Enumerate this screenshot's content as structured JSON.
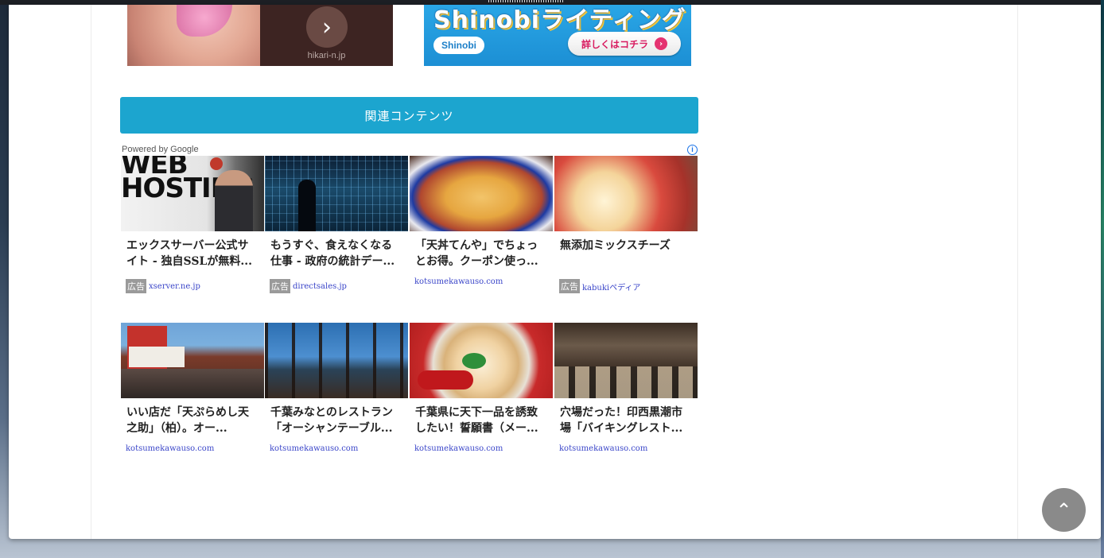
{
  "ads": {
    "left_banner": {
      "domain": "hikari-n.jp",
      "next_symbol": "›"
    },
    "right_banner": {
      "headline": "Shinobiライティング",
      "logo": "Shinobi",
      "cta": "詳しくはコチラ",
      "cta_arrow": "›"
    }
  },
  "related": {
    "header": "関連コンテンツ",
    "powered_by": "Powered by Google",
    "info_symbol": "i",
    "ad_label": "広告",
    "items": [
      {
        "title": "エックスサーバー公式サイト - 独自SSLが無料...",
        "source": "xserver.ne.jp",
        "sponsored": true
      },
      {
        "title": "もうすぐ、食えなくなる仕事 - 政府の統計デー...",
        "source": "directsales.jp",
        "sponsored": true
      },
      {
        "title": "「天丼てんや」でちょっとお得。クーポン使っ...",
        "source": "kotsumekawauso.com",
        "sponsored": false
      },
      {
        "title": "無添加ミックスチーズ",
        "source": "kabukiペディア",
        "sponsored": true
      },
      {
        "title": "いい店だ「天ぷらめし天之助」（柏）。オー...",
        "source": "kotsumekawauso.com",
        "sponsored": false
      },
      {
        "title": "千葉みなとのレストラン「オーシャンテーブル...",
        "source": "kotsumekawauso.com",
        "sponsored": false
      },
      {
        "title": "千葉県に天下一品を誘致したい！誓願書（メー...",
        "source": "kotsumekawauso.com",
        "sponsored": false
      },
      {
        "title": "穴場だった！印西黒潮市場「バイキングレスト...",
        "source": "kotsumekawauso.com",
        "sponsored": false
      }
    ]
  },
  "back_to_top_symbol": "⌃",
  "thumbnails": {
    "hosting_text": "WEB HOSTING"
  }
}
